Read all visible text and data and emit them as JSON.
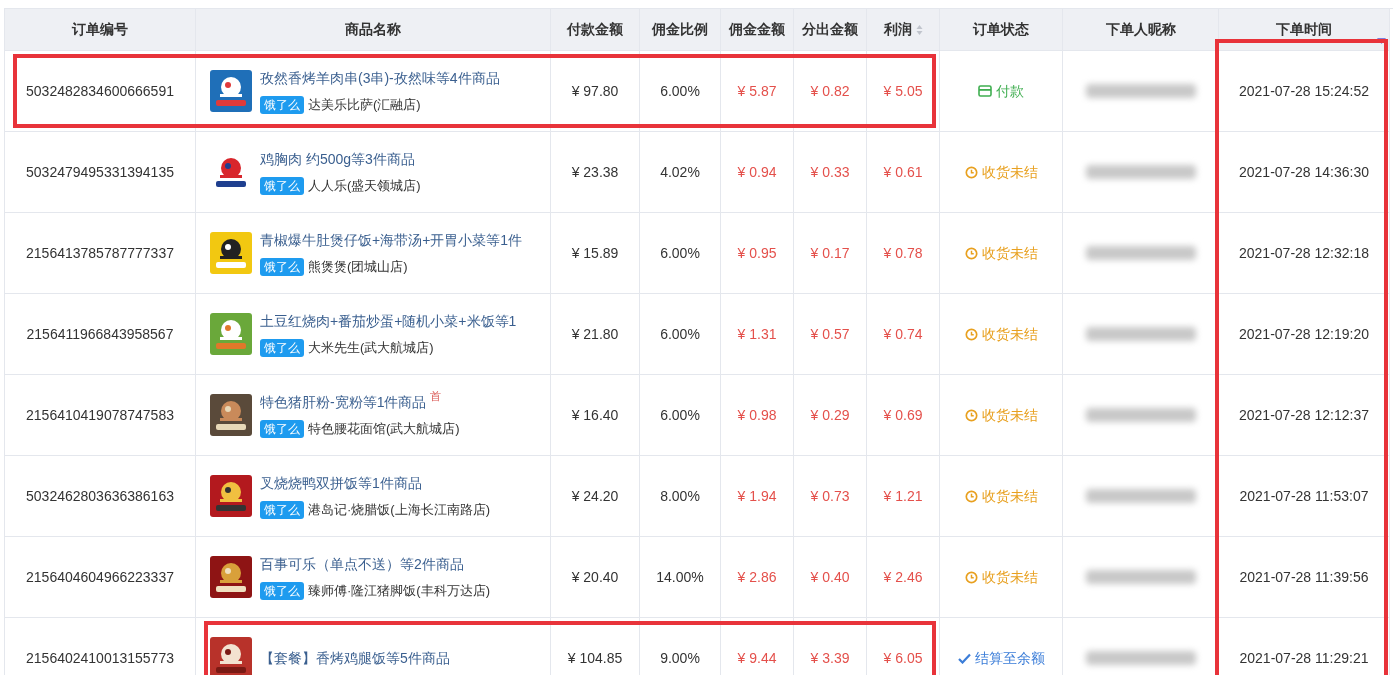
{
  "columns": [
    {
      "kind": "text",
      "label": "订单编号"
    },
    {
      "kind": "product",
      "label": "商品名称"
    },
    {
      "kind": "text",
      "label": "付款金额"
    },
    {
      "kind": "text",
      "label": "佣金比例"
    },
    {
      "kind": "earning",
      "label": "佣金金额"
    },
    {
      "kind": "earning",
      "label": "分出金额"
    },
    {
      "kind": "earning",
      "label": "利润",
      "sortable": true
    },
    {
      "kind": "status",
      "label": "订单状态"
    },
    {
      "kind": "nickname",
      "label": "下单人昵称"
    },
    {
      "kind": "text",
      "label": "下单时间",
      "sorted_descending": true,
      "highlighted": true
    }
  ],
  "rows": [
    {
      "cells": [
        {
          "text": "5032482834600666591",
          "highlighted": true
        },
        {
          "title": "孜然香烤羊肉串(3串)-孜然味等4件商品",
          "platform": "饿了么",
          "store": "达美乐比萨(汇融店)",
          "highlighted": true
        },
        {
          "text": "¥ 97.80",
          "highlighted": true
        },
        {
          "text": "6.00%",
          "highlighted": true
        },
        {
          "text": "¥ 5.87",
          "highlighted": true
        },
        {
          "text": "¥ 0.82",
          "highlighted": true
        },
        {
          "text": "¥ 5.05",
          "highlighted": true
        },
        {
          "kind": "paid",
          "label": "付款"
        },
        {
          "hidden": true
        },
        {
          "text": "2021-07-28 15:24:52"
        }
      ]
    },
    {
      "cells": [
        {
          "text": "5032479495331394135"
        },
        {
          "title": "鸡胸肉 约500g等3件商品",
          "platform": "饿了么",
          "store": "人人乐(盛天领城店)"
        },
        {
          "text": "¥ 23.38"
        },
        {
          "text": "4.02%"
        },
        {
          "text": "¥ 0.94"
        },
        {
          "text": "¥ 0.33"
        },
        {
          "text": "¥ 0.61"
        },
        {
          "kind": "pending",
          "label": "收货未结"
        },
        {
          "hidden": true
        },
        {
          "text": "2021-07-28 14:36:30"
        }
      ]
    },
    {
      "cells": [
        {
          "text": "2156413785787777337"
        },
        {
          "title": "青椒爆牛肚煲仔饭+海带汤+开胃小菜等1件",
          "platform": "饿了么",
          "store": "熊煲煲(团城山店)"
        },
        {
          "text": "¥ 15.89"
        },
        {
          "text": "6.00%"
        },
        {
          "text": "¥ 0.95"
        },
        {
          "text": "¥ 0.17"
        },
        {
          "text": "¥ 0.78"
        },
        {
          "kind": "pending",
          "label": "收货未结"
        },
        {
          "hidden": true
        },
        {
          "text": "2021-07-28 12:32:18"
        }
      ]
    },
    {
      "cells": [
        {
          "text": "2156411966843958567"
        },
        {
          "title": "土豆红烧肉+番茄炒蛋+随机小菜+米饭等1",
          "platform": "饿了么",
          "store": "大米先生(武大航城店)"
        },
        {
          "text": "¥ 21.80"
        },
        {
          "text": "6.00%"
        },
        {
          "text": "¥ 1.31"
        },
        {
          "text": "¥ 0.57"
        },
        {
          "text": "¥ 0.74"
        },
        {
          "kind": "pending",
          "label": "收货未结"
        },
        {
          "hidden": true
        },
        {
          "text": "2021-07-28 12:19:20"
        }
      ]
    },
    {
      "cells": [
        {
          "text": "2156410419078747583"
        },
        {
          "title": "特色猪肝粉-宽粉等1件商品",
          "tag": "首",
          "platform": "饿了么",
          "store": "特色腰花面馆(武大航城店)"
        },
        {
          "text": "¥ 16.40"
        },
        {
          "text": "6.00%"
        },
        {
          "text": "¥ 0.98"
        },
        {
          "text": "¥ 0.29"
        },
        {
          "text": "¥ 0.69"
        },
        {
          "kind": "pending",
          "label": "收货未结"
        },
        {
          "hidden": true
        },
        {
          "text": "2021-07-28 12:12:37"
        }
      ]
    },
    {
      "cells": [
        {
          "text": "5032462803636386163"
        },
        {
          "title": "叉烧烧鸭双拼饭等1件商品",
          "platform": "饿了么",
          "store": "港岛记·烧腊饭(上海长江南路店)"
        },
        {
          "text": "¥ 24.20"
        },
        {
          "text": "8.00%"
        },
        {
          "text": "¥ 1.94"
        },
        {
          "text": "¥ 0.73"
        },
        {
          "text": "¥ 1.21"
        },
        {
          "kind": "pending",
          "label": "收货未结"
        },
        {
          "hidden": true
        },
        {
          "text": "2021-07-28 11:53:07"
        }
      ]
    },
    {
      "cells": [
        {
          "text": "2156404604966223337"
        },
        {
          "title": "百事可乐（单点不送）等2件商品",
          "platform": "饿了么",
          "store": "臻师傅·隆江猪脚饭(丰科万达店)"
        },
        {
          "text": "¥ 20.40"
        },
        {
          "text": "14.00%"
        },
        {
          "text": "¥ 2.86"
        },
        {
          "text": "¥ 0.40"
        },
        {
          "text": "¥ 2.46"
        },
        {
          "kind": "pending",
          "label": "收货未结"
        },
        {
          "hidden": true
        },
        {
          "text": "2021-07-28 11:39:56"
        }
      ]
    },
    {
      "cells": [
        {
          "text": "2156402410013155773"
        },
        {
          "title": "【套餐】香烤鸡腿饭等5件商品",
          "highlighted": true
        },
        {
          "text": "¥ 104.85",
          "highlighted": true
        },
        {
          "text": "9.00%",
          "highlighted": true
        },
        {
          "text": "¥ 9.44",
          "highlighted": true
        },
        {
          "text": "¥ 3.39",
          "highlighted": true
        },
        {
          "text": "¥ 6.05",
          "highlighted": true
        },
        {
          "kind": "settled",
          "label": "结算至余额"
        },
        {
          "hidden": true
        },
        {
          "text": "2021-07-28 11:29:21"
        }
      ]
    }
  ]
}
